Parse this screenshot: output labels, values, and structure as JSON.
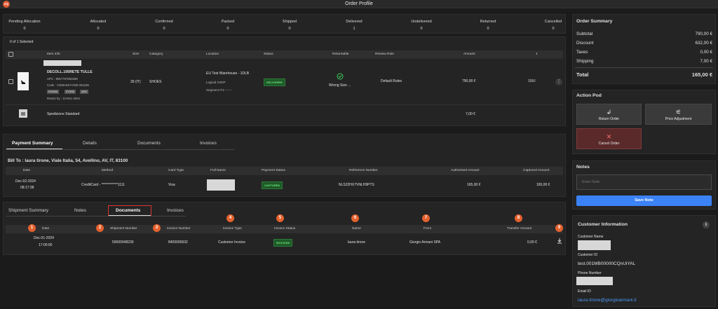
{
  "app": {
    "logo": "x/y",
    "title": "Order Profile"
  },
  "status_counts": [
    {
      "label": "Pending Allocation",
      "value": "0"
    },
    {
      "label": "Allocated",
      "value": "0"
    },
    {
      "label": "Confirmed",
      "value": "0"
    },
    {
      "label": "Packed",
      "value": "0"
    },
    {
      "label": "Shipped",
      "value": "0"
    },
    {
      "label": "Delivered",
      "value": "1"
    },
    {
      "label": "Undelivered",
      "value": "0"
    },
    {
      "label": "Returned",
      "value": "0"
    },
    {
      "label": "Cancelled",
      "value": "0"
    }
  ],
  "items": {
    "selected_text": "0 of 1 Selected",
    "headers": [
      "Item Info",
      "Size",
      "Category",
      "Location",
      "Status",
      "Returnable",
      "Review Rule",
      "Amount",
      "1"
    ],
    "row": {
      "name": "DECOLL.105RETE TULLE",
      "upc": "UPC : 8057767581696",
      "code": "Code : V1E9A6KYON5 00115N",
      "tags": [
        "K1E9A6",
        "KYON5",
        "A002"
      ],
      "return_by": "Return by : 12-Dec-2024",
      "size": "39 (IT)",
      "category": "SHOES",
      "location": "EU Test Warehouse - 1DLB",
      "logical": "Logical XIIOP",
      "segment": "Segment IT1-------",
      "status": "DELIVERED",
      "returnable": "Wrong Size ...",
      "review_rule": "Default Rules",
      "amount": "790,00 €",
      "extra": "15IU"
    },
    "shipping_row": {
      "label": "Spedizione Standard",
      "amount": "7,00 €"
    }
  },
  "payment": {
    "tabs": [
      "Payment Summary",
      "Details",
      "Documents",
      "Invoices"
    ],
    "bill_to": "Bill To : laura tirone, Viale Italia, 54, Avellino, AV, IT, 83100",
    "headers": [
      "Date",
      "Method",
      "Card Type",
      "Full Name",
      "Payment Status",
      "Reference Number",
      "Authorised Amount",
      "Captured Amount"
    ],
    "row": {
      "date": "Dec-02-2024",
      "time": "08:17:38",
      "method": "CreditCard - ************1111",
      "card_type": "Visa",
      "status": "CAPTURED",
      "reference": "NLS22HX7VNLH9PTS",
      "authorised": "165,00 €",
      "captured": "165,00 €"
    }
  },
  "shipment": {
    "tabs": [
      "Shipment Summary",
      "Notes",
      "Documents",
      "Invoices"
    ],
    "headers": [
      "Date",
      "Shipment Number",
      "Invoice Number",
      "Invoice Type",
      "Invoice Status",
      "Name",
      "From",
      "Transfer Amount"
    ],
    "markers": [
      "1",
      "2",
      "3",
      "4",
      "5",
      "6",
      "7",
      "8",
      "9"
    ],
    "row": {
      "date": "Dec-01-2024",
      "time": "17:00:00",
      "shipment_number": "50000048230",
      "invoice_number": "8400000632",
      "invoice_type": "Customer Invoice",
      "invoice_status": "INVOICED",
      "name": "laura tirone",
      "from": "Giorgio Armani SPA",
      "transfer_amount": "0,00 €"
    }
  },
  "summary": {
    "title": "Order Summary",
    "rows": [
      {
        "label": "Subtotal",
        "value": "790,00 €"
      },
      {
        "label": "Discount",
        "value": "632,00 €"
      },
      {
        "label": "Taxes",
        "value": "0,00 €"
      },
      {
        "label": "Shipping",
        "value": "7,00 €"
      }
    ],
    "total_label": "Total",
    "total_value": "165,00 €"
  },
  "action_pod": {
    "title": "Action Pod",
    "buttons": [
      {
        "label": "Return Order",
        "icon": "return-icon"
      },
      {
        "label": "Price Adjustment",
        "icon": "sliders-icon"
      },
      {
        "label": "Cancel Order",
        "icon": "close-icon"
      }
    ]
  },
  "notes": {
    "title": "Notes",
    "placeholder": "Enter Note",
    "button": "Save Note",
    "button_color": "#3b82f6"
  },
  "customer": {
    "title": "Customer Information",
    "name_label": "Customer Name",
    "id_label": "Customer ID",
    "id_value": "test.001MB00000CQnUiYAL",
    "phone_label": "Phone Number",
    "email_label": "Email ID",
    "email_value": "laura.tirone@giorgioarmani.it"
  }
}
